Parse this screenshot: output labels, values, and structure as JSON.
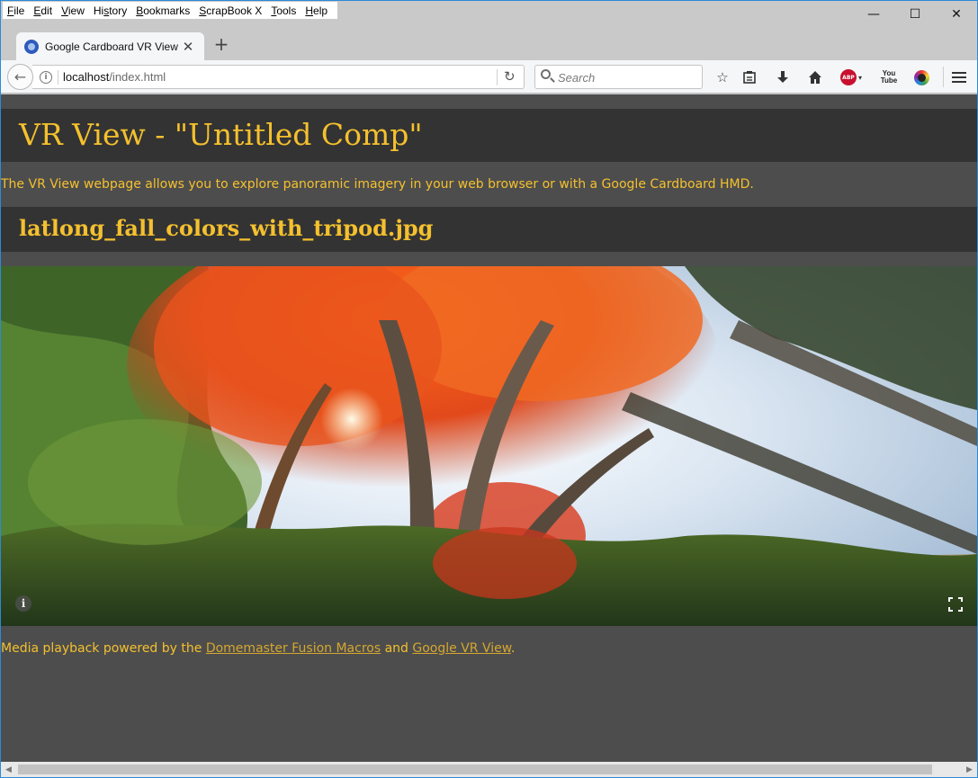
{
  "menu": {
    "items": [
      {
        "pre": "",
        "u": "F",
        "post": "ile"
      },
      {
        "pre": "",
        "u": "E",
        "post": "dit"
      },
      {
        "pre": "",
        "u": "V",
        "post": "iew"
      },
      {
        "pre": "Hi",
        "u": "s",
        "post": "tory"
      },
      {
        "pre": "",
        "u": "B",
        "post": "ookmarks"
      },
      {
        "pre": "",
        "u": "S",
        "post": "crapBook X"
      },
      {
        "pre": "",
        "u": "T",
        "post": "ools"
      },
      {
        "pre": "",
        "u": "H",
        "post": "elp"
      }
    ]
  },
  "window_controls": {
    "minimize": "—",
    "maximize": "☐",
    "close": "✕"
  },
  "tab": {
    "title": "Google Cardboard VR View",
    "close": "✕"
  },
  "new_tab": "+",
  "navbar": {
    "url_host": "localhost",
    "url_path": "/index.html",
    "search_placeholder": "Search",
    "icons": [
      "back-arrow-icon",
      "info-icon",
      "reload-icon",
      "search-icon",
      "star-icon",
      "reading-list-icon",
      "download-icon",
      "home-icon",
      "adblock-plus-icon",
      "youtube-icon",
      "color-picker-icon",
      "menu-icon"
    ]
  },
  "abp_label": "ABP",
  "youtube_label_1": "You",
  "youtube_label_2": "Tube",
  "page": {
    "title": "VR View - \"Untitled Comp\"",
    "intro": "The VR View webpage allows you to explore panoramic imagery in your web browser or with a Google Cardboard HMD.",
    "media_filename": "latlong_fall_colors_with_tripod.jpg",
    "footer_prefix": "Media playback powered by the ",
    "footer_link1": "Domemaster Fusion Macros",
    "footer_mid": " and ",
    "footer_link2": "Google VR View",
    "footer_suffix": "."
  },
  "vr_viewer": {
    "info_glyph": "i"
  },
  "colors": {
    "accent": "#f4c02e",
    "title_bg": "#333333",
    "page_bg": "#4d4d4d"
  }
}
